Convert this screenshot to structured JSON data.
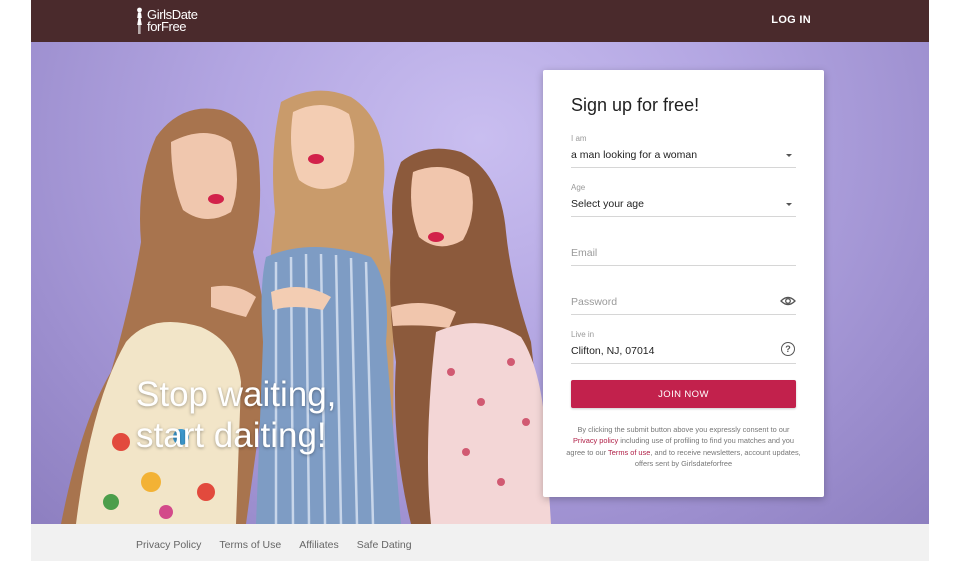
{
  "header": {
    "logo_line1": "GirlsDate",
    "logo_line2": "forFree",
    "login_label": "LOG IN",
    "background_color": "#4a2a2c"
  },
  "hero": {
    "tagline_line1": "Stop waiting,",
    "tagline_line2": "start daiting!"
  },
  "signup": {
    "title": "Sign up for free!",
    "i_am": {
      "label": "I am",
      "value": "a man looking for a woman"
    },
    "age": {
      "label": "Age",
      "value": "Select your age"
    },
    "email": {
      "placeholder": "Email"
    },
    "password": {
      "placeholder": "Password",
      "icon": "eye-icon"
    },
    "location": {
      "label": "Live in",
      "value": "Clifton, NJ, 07014",
      "icon": "help-icon"
    },
    "join_label": "JOIN NOW",
    "accent_color": "#c2214c",
    "legal": {
      "part1": "By clicking the submit button above you expressly consent to our ",
      "privacy_link": "Privacy policy",
      "part2": " including use of profiling to find you matches and you agree to our ",
      "terms_link": "Terms of use",
      "part3": ", and to receive newsletters, account updates, offers sent by Girlsdateforfree"
    }
  },
  "footer": {
    "links": [
      "Privacy Policy",
      "Terms of Use",
      "Affiliates",
      "Safe Dating"
    ]
  }
}
